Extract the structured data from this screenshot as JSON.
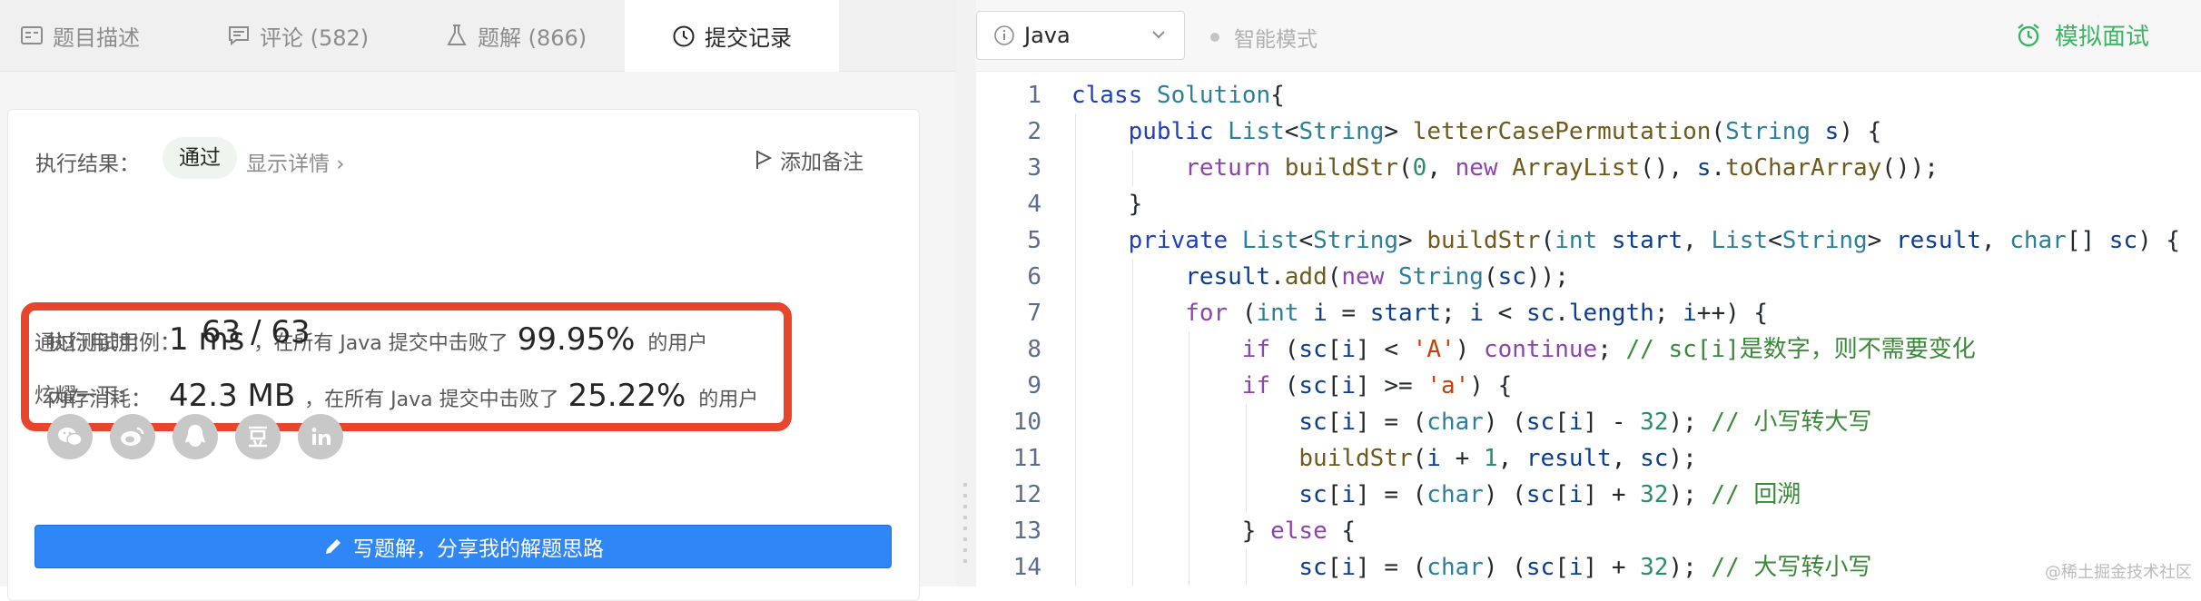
{
  "tabs": [
    {
      "label": "题目描述",
      "icon": "document-icon"
    },
    {
      "label": "评论 (582)",
      "icon": "comment-icon"
    },
    {
      "label": "题解 (866)",
      "icon": "flask-icon"
    },
    {
      "label": "提交记录",
      "icon": "clock-icon",
      "active": true
    }
  ],
  "result": {
    "label": "执行结果：",
    "status": "通过",
    "details_link": "显示详情 ›",
    "add_note": "添加备注"
  },
  "runtime": {
    "label": "执行用时：",
    "value": "1 ms",
    "mid": "，在所有 Java 提交中击败了",
    "percent": "99.95%",
    "tail": "的用户"
  },
  "memory": {
    "label": "内存消耗：",
    "value": "42.3 MB",
    "mid": "，在所有 Java 提交中击败了",
    "percent": "25.22%",
    "tail": "的用户"
  },
  "testcases": {
    "label": "通过测试用例：",
    "value": "63 / 63"
  },
  "share": {
    "label": "炫耀一下:",
    "icons": [
      "wechat-icon",
      "weibo-icon",
      "qq-icon",
      "douban-icon",
      "linkedin-icon"
    ]
  },
  "write_button": "写题解，分享我的解题思路",
  "editor": {
    "language": "Java",
    "smart_mode": "智能模式",
    "mock_interview": "模拟面试",
    "code_lines": [
      {
        "n": "1",
        "indent": 0,
        "tokens": [
          [
            "kw2",
            "class "
          ],
          [
            "ty",
            "Solution"
          ],
          [
            "",
            "{"
          ]
        ]
      },
      {
        "n": "2",
        "indent": 1,
        "tokens": [
          [
            "kw2",
            "public "
          ],
          [
            "ty",
            "List"
          ],
          [
            "",
            "<"
          ],
          [
            "ty",
            "String"
          ],
          [
            "",
            "> "
          ],
          [
            "fn",
            "letterCasePermutation"
          ],
          [
            "",
            "("
          ],
          [
            "ty",
            "String"
          ],
          [
            "",
            " "
          ],
          [
            "prm",
            "s"
          ],
          [
            "",
            ") {"
          ]
        ]
      },
      {
        "n": "3",
        "indent": 2,
        "tokens": [
          [
            "kw",
            "return "
          ],
          [
            "fn",
            "buildStr"
          ],
          [
            "",
            "("
          ],
          [
            "num",
            "0"
          ],
          [
            "",
            ", "
          ],
          [
            "kw",
            "new "
          ],
          [
            "fn",
            "ArrayList"
          ],
          [
            "",
            "(), "
          ],
          [
            "prm",
            "s"
          ],
          [
            "",
            "."
          ],
          [
            "fn",
            "toCharArray"
          ],
          [
            "",
            "());"
          ]
        ]
      },
      {
        "n": "4",
        "indent": 1,
        "tokens": [
          [
            "",
            "}"
          ]
        ]
      },
      {
        "n": "5",
        "indent": 1,
        "tokens": [
          [
            "kw2",
            "private "
          ],
          [
            "ty",
            "List"
          ],
          [
            "",
            "<"
          ],
          [
            "ty",
            "String"
          ],
          [
            "",
            "> "
          ],
          [
            "fn",
            "buildStr"
          ],
          [
            "",
            "("
          ],
          [
            "ty",
            "int"
          ],
          [
            "",
            " "
          ],
          [
            "prm",
            "start"
          ],
          [
            "",
            ", "
          ],
          [
            "ty",
            "List"
          ],
          [
            "",
            "<"
          ],
          [
            "ty",
            "String"
          ],
          [
            "",
            "> "
          ],
          [
            "prm",
            "result"
          ],
          [
            "",
            ", "
          ],
          [
            "ty",
            "char"
          ],
          [
            "",
            "[] "
          ],
          [
            "prm",
            "sc"
          ],
          [
            "",
            ") {"
          ]
        ]
      },
      {
        "n": "6",
        "indent": 2,
        "tokens": [
          [
            "prm",
            "result"
          ],
          [
            "",
            "."
          ],
          [
            "fn",
            "add"
          ],
          [
            "",
            "("
          ],
          [
            "kw",
            "new "
          ],
          [
            "ty",
            "String"
          ],
          [
            "",
            "("
          ],
          [
            "prm",
            "sc"
          ],
          [
            "",
            "));"
          ]
        ]
      },
      {
        "n": "7",
        "indent": 2,
        "tokens": [
          [
            "kw",
            "for "
          ],
          [
            "",
            "("
          ],
          [
            "ty",
            "int"
          ],
          [
            "",
            " "
          ],
          [
            "prm",
            "i"
          ],
          [
            "",
            " = "
          ],
          [
            "prm",
            "start"
          ],
          [
            "",
            "; "
          ],
          [
            "prm",
            "i"
          ],
          [
            "",
            " < "
          ],
          [
            "prm",
            "sc"
          ],
          [
            "",
            "."
          ],
          [
            "prm",
            "length"
          ],
          [
            "",
            "; "
          ],
          [
            "prm",
            "i"
          ],
          [
            "",
            "++) {"
          ]
        ]
      },
      {
        "n": "8",
        "indent": 3,
        "tokens": [
          [
            "kw",
            "if "
          ],
          [
            "",
            "("
          ],
          [
            "prm",
            "sc"
          ],
          [
            "",
            "["
          ],
          [
            "prm",
            "i"
          ],
          [
            "",
            "] < "
          ],
          [
            "str",
            "'A'"
          ],
          [
            "",
            ") "
          ],
          [
            "kw",
            "continue"
          ],
          [
            "",
            "; "
          ],
          [
            "cm",
            "// sc[i]是数字，则不需要变化"
          ]
        ]
      },
      {
        "n": "9",
        "indent": 3,
        "tokens": [
          [
            "kw",
            "if "
          ],
          [
            "",
            "("
          ],
          [
            "prm",
            "sc"
          ],
          [
            "",
            "["
          ],
          [
            "prm",
            "i"
          ],
          [
            "",
            "] >= "
          ],
          [
            "str",
            "'a'"
          ],
          [
            "",
            ") {"
          ]
        ]
      },
      {
        "n": "10",
        "indent": 4,
        "tokens": [
          [
            "prm",
            "sc"
          ],
          [
            "",
            "["
          ],
          [
            "prm",
            "i"
          ],
          [
            "",
            "] = ("
          ],
          [
            "ty",
            "char"
          ],
          [
            "",
            ") ("
          ],
          [
            "prm",
            "sc"
          ],
          [
            "",
            "["
          ],
          [
            "prm",
            "i"
          ],
          [
            "",
            "] - "
          ],
          [
            "num",
            "32"
          ],
          [
            "",
            "); "
          ],
          [
            "cm",
            "// 小写转大写"
          ]
        ]
      },
      {
        "n": "11",
        "indent": 4,
        "tokens": [
          [
            "fn",
            "buildStr"
          ],
          [
            "",
            "("
          ],
          [
            "prm",
            "i"
          ],
          [
            "",
            " + "
          ],
          [
            "num",
            "1"
          ],
          [
            "",
            ", "
          ],
          [
            "prm",
            "result"
          ],
          [
            "",
            ", "
          ],
          [
            "prm",
            "sc"
          ],
          [
            "",
            ");"
          ]
        ]
      },
      {
        "n": "12",
        "indent": 4,
        "tokens": [
          [
            "prm",
            "sc"
          ],
          [
            "",
            "["
          ],
          [
            "prm",
            "i"
          ],
          [
            "",
            "] = ("
          ],
          [
            "ty",
            "char"
          ],
          [
            "",
            ") ("
          ],
          [
            "prm",
            "sc"
          ],
          [
            "",
            "["
          ],
          [
            "prm",
            "i"
          ],
          [
            "",
            "] + "
          ],
          [
            "num",
            "32"
          ],
          [
            "",
            "); "
          ],
          [
            "cm",
            "// 回溯"
          ]
        ]
      },
      {
        "n": "13",
        "indent": 3,
        "tokens": [
          [
            "",
            "} "
          ],
          [
            "kw",
            "else "
          ],
          [
            "",
            "{"
          ]
        ]
      },
      {
        "n": "14",
        "indent": 4,
        "tokens": [
          [
            "prm",
            "sc"
          ],
          [
            "",
            "["
          ],
          [
            "prm",
            "i"
          ],
          [
            "",
            "] = ("
          ],
          [
            "ty",
            "char"
          ],
          [
            "",
            ") ("
          ],
          [
            "prm",
            "sc"
          ],
          [
            "",
            "["
          ],
          [
            "prm",
            "i"
          ],
          [
            "",
            "] + "
          ],
          [
            "num",
            "32"
          ],
          [
            "",
            "); "
          ],
          [
            "cm",
            "// 大写转小写"
          ]
        ]
      }
    ]
  },
  "watermark": "@稀土掘金技术社区"
}
